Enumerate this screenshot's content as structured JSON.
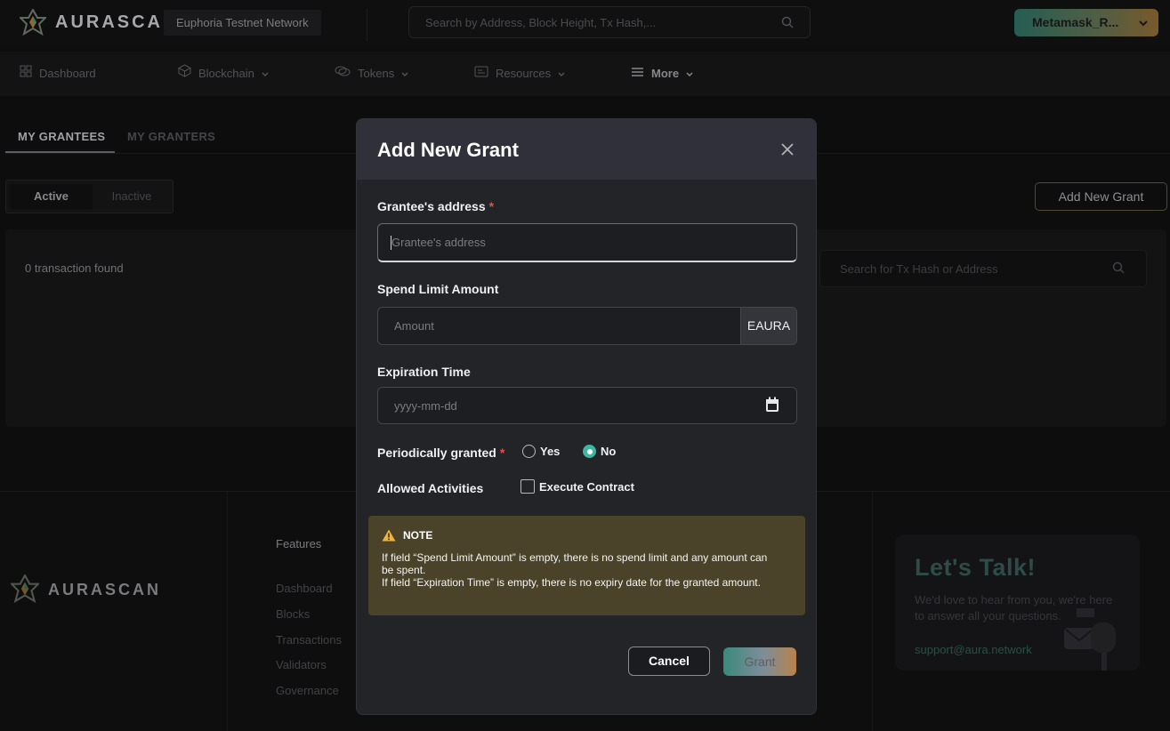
{
  "header": {
    "brand": "AURASCAN",
    "network": "Euphoria Testnet Network",
    "search_placeholder": "Search by Address, Block Height, Tx Hash,...",
    "wallet_label": "Metamask_R..."
  },
  "nav": {
    "items": [
      {
        "label": "Dashboard",
        "icon": "grid-icon"
      },
      {
        "label": "Blockchain",
        "icon": "cube-icon"
      },
      {
        "label": "Tokens",
        "icon": "coins-icon"
      },
      {
        "label": "Resources",
        "icon": "card-icon"
      },
      {
        "label": "More",
        "icon": "menu-icon"
      }
    ]
  },
  "tabs": {
    "grantees": "MY GRANTEES",
    "granters": "MY GRANTERS"
  },
  "filter": {
    "active": "Active",
    "inactive": "Inactive"
  },
  "add_new_grant_button": "Add New Grant",
  "results": {
    "count_text": "0 transaction found",
    "search_placeholder": "Search for Tx Hash or Address"
  },
  "footer": {
    "brand": "AURASCAN",
    "features_heading": "Features",
    "links": [
      "Dashboard",
      "Blocks",
      "Transactions",
      "Validators",
      "Governance"
    ],
    "talk_title": "Let's Talk!",
    "talk_text": "We'd love to hear from you, we're here to answer all your questions.",
    "email": "support@aura.network"
  },
  "modal": {
    "title": "Add New Grant",
    "grantee_label": "Grantee's address",
    "grantee_placeholder": "Grantee's address",
    "spend_label": "Spend Limit Amount",
    "amount_placeholder": "Amount",
    "unit": "EAURA",
    "expiration_label": "Expiration Time",
    "date_placeholder": "yyyy-mm-dd",
    "periodic_label": "Periodically granted",
    "option_yes": "Yes",
    "option_no": "No",
    "periodic_selected": "No",
    "activities_label": "Allowed Activities",
    "execute_contract": "Execute Contract",
    "execute_contract_checked": false,
    "note_title": "NOTE",
    "note_line1": "If field “Spend Limit Amount” is empty, there is no spend limit and any amount can be spent.",
    "note_line2": "If field “Expiration Time” is empty, there is no expiry date for the granted amount.",
    "cancel": "Cancel",
    "grant": "Grant"
  },
  "colors": {
    "accent": "#3bb7a2",
    "note_bg": "#4b4329",
    "required": "#e0514a"
  }
}
